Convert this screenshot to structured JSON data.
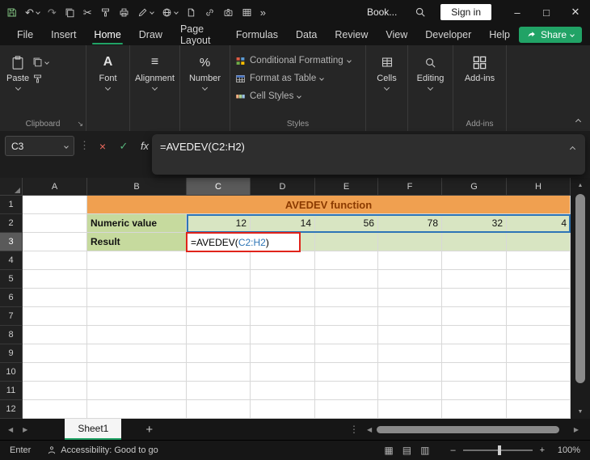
{
  "titlebar": {
    "workbook_name": "Book...",
    "signin_label": "Sign in"
  },
  "menubar": {
    "items": [
      "File",
      "Insert",
      "Home",
      "Draw",
      "Page Layout",
      "Formulas",
      "Data",
      "Review",
      "View",
      "Developer",
      "Help"
    ],
    "active_index": 2,
    "share_label": "Share"
  },
  "ribbon": {
    "clipboard": {
      "group_label": "Clipboard",
      "paste_label": "Paste"
    },
    "font_label": "Font",
    "alignment_label": "Alignment",
    "number_label": "Number",
    "styles": {
      "group_label": "Styles",
      "conditional": "Conditional Formatting",
      "format_table": "Format as Table",
      "cell_styles": "Cell Styles"
    },
    "cells_label": "Cells",
    "editing_label": "Editing",
    "addins_label": "Add-ins",
    "addins_group_label": "Add-ins"
  },
  "formula_bar": {
    "name_box": "C3",
    "fx": "fx",
    "formula": "=AVEDEV(C2:H2)"
  },
  "grid": {
    "columns": [
      "A",
      "B",
      "C",
      "D",
      "E",
      "F",
      "G",
      "H"
    ],
    "rows": [
      "1",
      "2",
      "3",
      "4",
      "5",
      "6",
      "7",
      "8",
      "9",
      "10",
      "11",
      "12"
    ],
    "banner_text": "AVEDEV function",
    "numeric_label": "Numeric value",
    "values": [
      "12",
      "14",
      "56",
      "78",
      "32",
      "4"
    ],
    "result_label": "Result",
    "cell_formula": {
      "prefix": "=AVEDEV(",
      "ref": "C2:H2",
      "suffix": ")"
    }
  },
  "sheet_bar": {
    "tab": "Sheet1",
    "add": "+"
  },
  "status_bar": {
    "mode": "Enter",
    "accessibility": "Accessibility: Good to go",
    "zoom_level": "100%"
  },
  "colors": {
    "accent_green": "#21A366",
    "banner_orange": "#F0A050",
    "banner_text": "#8B3A00",
    "cell_green_label": "#C6DA9E",
    "cell_green_value": "#D8E5C2",
    "reference_blue": "#2E75B6",
    "annotation_red": "#E0241B"
  }
}
